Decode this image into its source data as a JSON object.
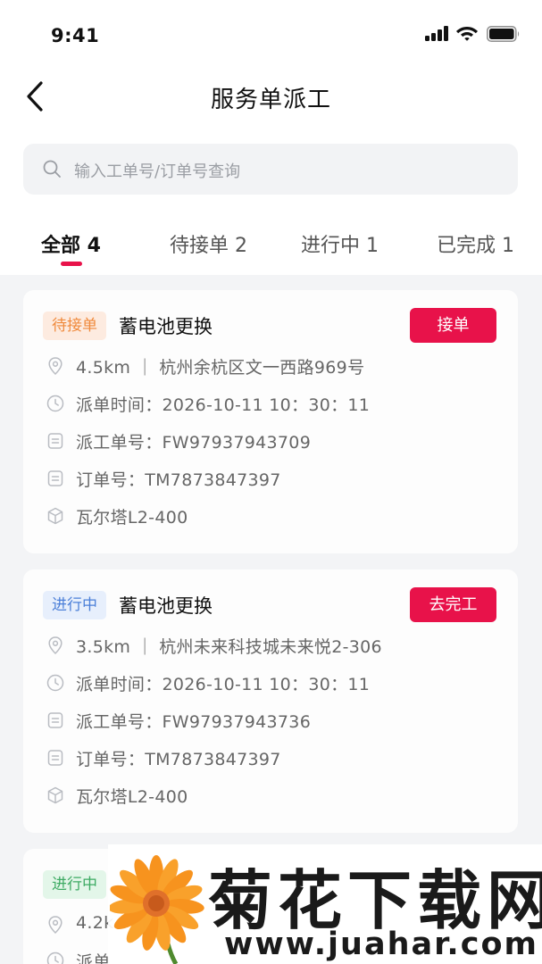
{
  "status_bar": {
    "time": "9:41"
  },
  "header": {
    "title": "服务单派工"
  },
  "search": {
    "placeholder": "输入工单号/订单号查询"
  },
  "tabs": [
    {
      "label": "全部 4",
      "active": true
    },
    {
      "label": "待接单 2",
      "active": false
    },
    {
      "label": "进行中 1",
      "active": false
    },
    {
      "label": "已完成 1",
      "active": false
    }
  ],
  "orders": [
    {
      "status": "待接单",
      "status_color": "#f08a3c",
      "title": "蓄电池更换",
      "action": "接单",
      "location": "4.5km ｜ 杭州余杭区文一西路969号",
      "dispatch_time": "派单时间：2026-10-11 10：30：11",
      "work_no": "派工单号：FW97937943709",
      "order_no": "订单号：TM7873847397",
      "product": "瓦尔塔L2-400"
    },
    {
      "status": "进行中",
      "status_color": "#4b7fd8",
      "title": "蓄电池更换",
      "action": "去完工",
      "location": "3.5km ｜ 杭州未来科技城未来悦2-306",
      "dispatch_time": "派单时间：2026-10-11 10：30：11",
      "work_no": "派工单号：FW97937943736",
      "order_no": "订单号：TM7873847397",
      "product": "瓦尔塔L2-400"
    },
    {
      "status": "进行中",
      "status_color": "#3daa63",
      "location": "4.2k",
      "dispatch_time": "派单"
    }
  ],
  "watermark": {
    "text": "菊花下载网",
    "url": "www.juahar.com"
  },
  "colors": {
    "accent": "#e8124a",
    "background": "#f3f4f6"
  }
}
